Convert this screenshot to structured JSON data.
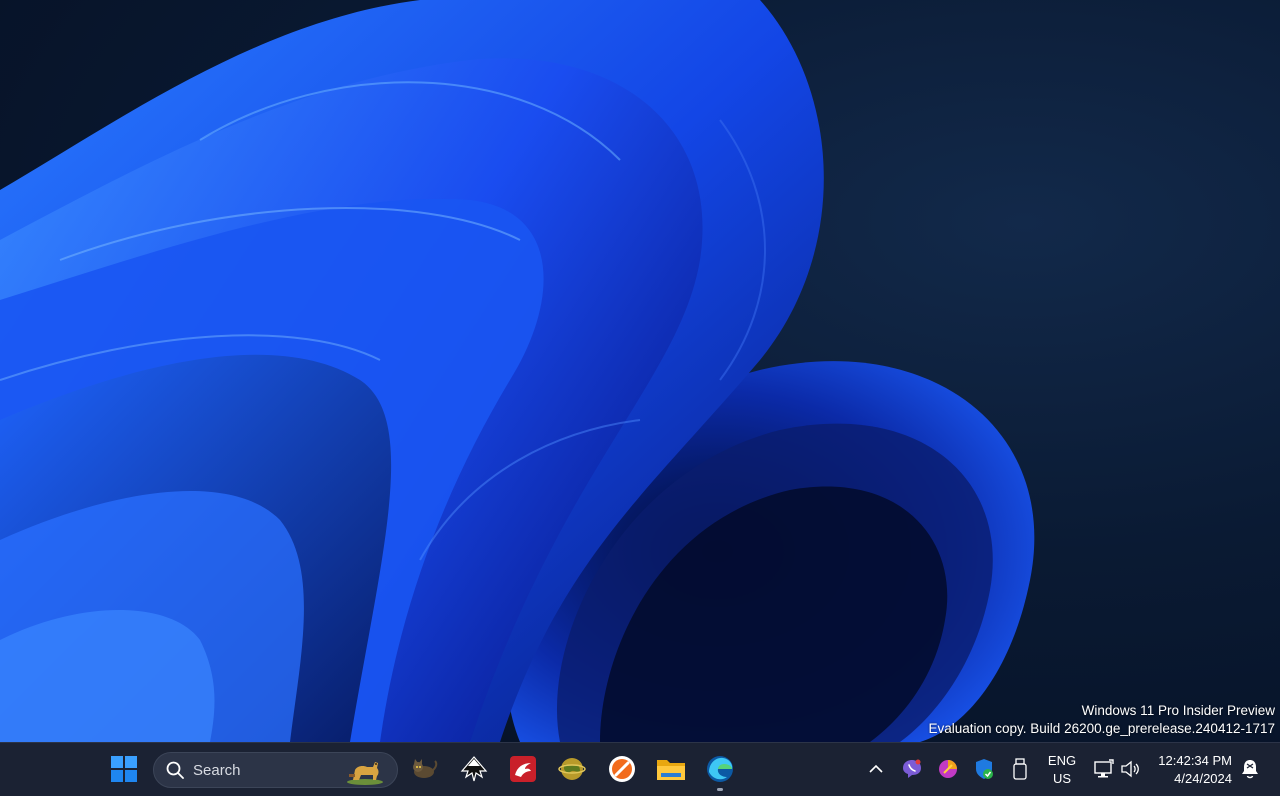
{
  "watermark": {
    "line1": "Windows 11 Pro Insider Preview",
    "line2": "Evaluation copy. Build 26200.ge_prerelease.240412-1717"
  },
  "taskbar": {
    "start_icon": "windows-logo-icon",
    "search": {
      "label": "Search"
    },
    "apps": [
      {
        "icon": "cat-app-icon"
      },
      {
        "icon": "inkscape-icon"
      },
      {
        "icon": "dragon-app-icon"
      },
      {
        "icon": "globe-app-icon"
      },
      {
        "icon": "orange-circle-app-icon"
      },
      {
        "icon": "file-explorer-icon"
      },
      {
        "icon": "edge-browser-icon"
      }
    ],
    "tray": {
      "language_line1": "ENG",
      "language_line2": "US",
      "time": "12:42:34 PM",
      "date": "4/24/2024"
    }
  },
  "colors": {
    "wallpaper_blue": "#1a5cff",
    "taskbar_bg": "#1b2233",
    "accent": "#0078d4"
  }
}
